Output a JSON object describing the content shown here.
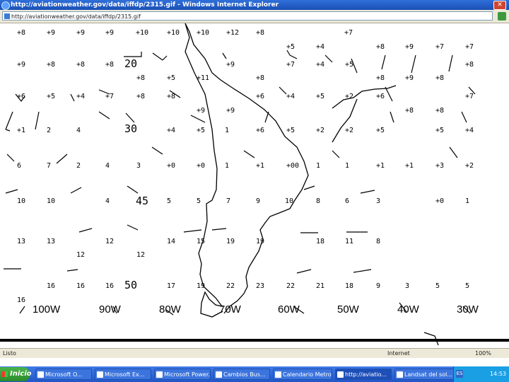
{
  "window": {
    "title": "http://aviationweather.gov/data/iffdp/2315.gif - Windows Internet Explorer",
    "close_glyph": "✕"
  },
  "address": {
    "url": "http://aviationweather.gov/data/iffdp/2315.gif"
  },
  "map": {
    "pressure_labels": [
      "20",
      "30",
      "45",
      "50"
    ],
    "longitude_labels": [
      "100W",
      "90W",
      "80W",
      "70W",
      "60W",
      "50W",
      "40W",
      "30W"
    ],
    "rows": [
      [
        "+8",
        "+9",
        "+9",
        "+9",
        "+10",
        "+10",
        "+10",
        "+12",
        "+8",
        "+7"
      ],
      [
        "+5",
        "+4",
        "+8",
        "+9",
        "+7",
        "+7"
      ],
      [
        "+9",
        "+8",
        "+8",
        "+8",
        "+9",
        "+7",
        "+4",
        "+5",
        "+8"
      ],
      [
        "+8",
        "+5",
        "+11",
        "+8",
        "+8",
        "+9",
        "+8"
      ],
      [
        "+6",
        "+5",
        "+4",
        "+7",
        "+8",
        "+8",
        "+6",
        "+4",
        "+5",
        "+2",
        "+6",
        "+7"
      ],
      [
        "+9",
        "+9",
        "+8",
        "+8"
      ],
      [
        "+1",
        "2",
        "4",
        "+4",
        "+5",
        "1",
        "+6",
        "+5",
        "+2",
        "+2",
        "+5",
        "+5",
        "+4"
      ],
      [
        "6",
        "7",
        "2",
        "4",
        "3",
        "+0",
        "+0",
        "1",
        "+1",
        "+00",
        "1",
        "1",
        "+1",
        "+1",
        "+3",
        "+2"
      ],
      [
        "10",
        "10",
        "4",
        "5",
        "5",
        "7",
        "9",
        "10",
        "8",
        "6",
        "3",
        "+0",
        "1"
      ],
      [
        "13",
        "13",
        "12",
        "14",
        "15",
        "19",
        "19",
        "18",
        "11",
        "8"
      ],
      [
        "12",
        "12"
      ],
      [
        "16",
        "16",
        "16",
        "17",
        "19",
        "22",
        "23",
        "22",
        "21",
        "18",
        "9",
        "3",
        "5",
        "5"
      ],
      [
        "16"
      ]
    ]
  },
  "status": {
    "left_text": "Listo",
    "zone_text": "Internet",
    "zoom_text": "100%"
  },
  "taskbar": {
    "start_label": "Inicio",
    "lang": "ES",
    "clock": "14:53",
    "tasks": [
      "Microsoft O...",
      "Microsoft Ex...",
      "Microsoft Power...",
      "Cambios Bus...",
      "Calendario Metro...",
      "http://aviatio...",
      "Landsat del sol..."
    ]
  }
}
